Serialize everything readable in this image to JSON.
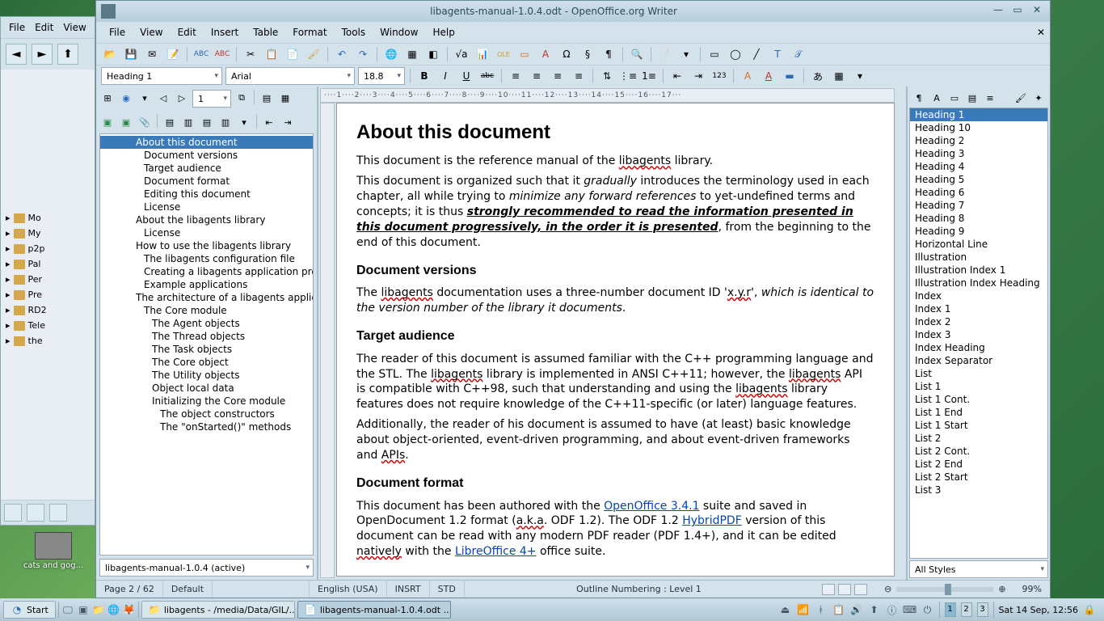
{
  "desktop": {
    "icon_label": "cats and gog..."
  },
  "fm": {
    "menu": [
      "File",
      "Edit",
      "View"
    ],
    "side_items": [
      "Mo",
      "My",
      "p2p",
      "Pal",
      "Per",
      "Pre",
      "RD2",
      "Tele",
      "the"
    ]
  },
  "window": {
    "title": "libagents-manual-1.0.4.odt - OpenOffice.org Writer"
  },
  "menubar": [
    "File",
    "View",
    "Edit",
    "Insert",
    "Table",
    "Format",
    "Tools",
    "Window",
    "Help"
  ],
  "format_combo": {
    "para_style": "Heading 1",
    "font_name": "Arial",
    "font_size": "18.8"
  },
  "navigator": {
    "page_input": "1",
    "outline": [
      {
        "text": "About this document",
        "level": 1,
        "selected": true
      },
      {
        "text": "Document versions",
        "level": 2
      },
      {
        "text": "Target audience",
        "level": 2
      },
      {
        "text": "Document format",
        "level": 2
      },
      {
        "text": "Editing this document",
        "level": 2
      },
      {
        "text": "License",
        "level": 2
      },
      {
        "text": "About the libagents library",
        "level": 1
      },
      {
        "text": "License",
        "level": 2
      },
      {
        "text": "How to use the libagents library",
        "level": 1
      },
      {
        "text": "The libagents configuration file",
        "level": 2
      },
      {
        "text": "Creating a libagents application project",
        "level": 2
      },
      {
        "text": "Example applications",
        "level": 2
      },
      {
        "text": "The architecture of a libagents application",
        "level": 1
      },
      {
        "text": "The Core module",
        "level": 2
      },
      {
        "text": "The Agent objects",
        "level": 3
      },
      {
        "text": "The Thread objects",
        "level": 3
      },
      {
        "text": "The Task objects",
        "level": 3
      },
      {
        "text": "The Core object",
        "level": 3
      },
      {
        "text": "The Utility objects",
        "level": 3
      },
      {
        "text": "Object local data",
        "level": 3
      },
      {
        "text": "Initializing the Core module",
        "level": 3
      },
      {
        "text": "The object constructors",
        "level": 4
      },
      {
        "text": "The \"onStarted()\" methods",
        "level": 4
      }
    ],
    "doc_selector": "libagents-manual-1.0.4 (active)"
  },
  "document": {
    "h1": "About this document",
    "p1a": "This document is the reference manual of the ",
    "p1b": "libagents",
    "p1c": " library.",
    "p2a": "This document is organized such that it ",
    "p2b": "gradually",
    "p2c": " introduces the terminology used in each chapter, all while trying to ",
    "p2d": "minimize any forward references",
    "p2e": " to yet-undefined terms and concepts; it is thus ",
    "p2f": "strongly recommended to read the information presented in this document progressively, in the order it is presented",
    "p2g": ", from the beginning to the end of this document.",
    "h2a": "Document versions",
    "p3a": "The ",
    "p3b": "libagents",
    "p3c": " documentation uses a three-number document ID '",
    "p3d": "x.y.r",
    "p3e": "', ",
    "p3f": "which is identical to the version number of the library it documents",
    "p3g": ".",
    "h2b": "Target audience",
    "p4": "The reader of this document is assumed familiar with the C++ programming language and the STL. The ",
    "p4b": "libagents",
    "p4c": " library is implemented in ANSI C++11; however, the ",
    "p4d": "libagents",
    "p4e": " API is compatible with C++98, such that understanding and using the ",
    "p4f": "libagents",
    "p4g": " library features does not require knowledge of the C++11-specific (or later) language features.",
    "p5a": "Additionally, the reader of his document is assumed to have (at least) basic knowledge about object-oriented, event-driven programming, and about event-driven frameworks and ",
    "p5b": "APIs",
    "p5c": ".",
    "h2c": "Document format",
    "p6a": "This document has been authored with the ",
    "p6b": "OpenOffice 3.4.1",
    "p6c": " suite and saved in OpenDocument 1.2 format (",
    "p6d": "a.k.a",
    "p6e": ". ODF 1.2). The ODF 1.2 ",
    "p6f": "HybridPDF",
    "p6g": " version of this document can be read with any modern PDF reader (PDF 1.4+), and it can be edited ",
    "p6h": "natively",
    "p6i": " with the ",
    "p6j": "LibreOffice 4+",
    "p6k": " office suite."
  },
  "styles": {
    "list": [
      "Heading 1",
      "Heading 10",
      "Heading 2",
      "Heading 3",
      "Heading 4",
      "Heading 5",
      "Heading 6",
      "Heading 7",
      "Heading 8",
      "Heading 9",
      "Horizontal Line",
      "Illustration",
      "Illustration Index 1",
      "Illustration Index Heading",
      "Index",
      "Index 1",
      "Index 2",
      "Index 3",
      "Index Heading",
      "Index Separator",
      "List",
      "List 1",
      "List 1 Cont.",
      "List 1 End",
      "List 1 Start",
      "List 2",
      "List 2 Cont.",
      "List 2 End",
      "List 2 Start",
      "List 3"
    ],
    "selected": 0,
    "filter": "All Styles"
  },
  "statusbar": {
    "page": "Page 2 / 62",
    "style": "Default",
    "lang": "English (USA)",
    "insert": "INSRT",
    "sel": "STD",
    "outline": "Outline Numbering : Level 1",
    "zoom": "99%"
  },
  "ruler_text": "····1····2····3····4····5····6····7····8····9····10····11····12····13····14····15····16····17···",
  "taskbar": {
    "start": "Start",
    "tasks": [
      {
        "label": "libagents - /media/Data/GIL/...",
        "active": false
      },
      {
        "label": "libagents-manual-1.0.4.odt ...",
        "active": true
      }
    ],
    "workspaces": [
      "1",
      "2",
      "3"
    ],
    "active_ws": 0,
    "clock": "Sat 14 Sep, 12:56"
  }
}
